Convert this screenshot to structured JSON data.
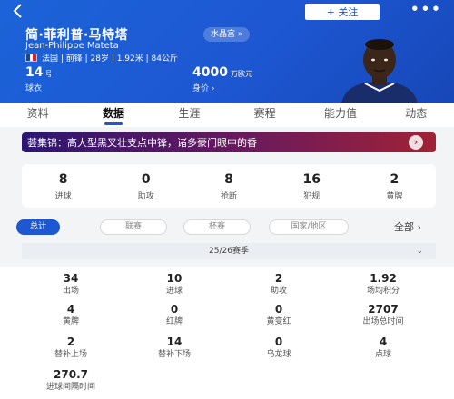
{
  "header": {
    "back_icon": "chevron-left-icon",
    "follow_label": "+ 关注",
    "more_label": "•••",
    "name": "简·菲利普·马特塔",
    "tag": "水晶宫 »",
    "english_name": "Jean-Philippe Mateta",
    "country_flag": "france-flag-icon",
    "info": "法国 | 前锋 | 28岁 | 1.92米 | 84公斤",
    "shirt_number": "14",
    "shirt_unit": "号",
    "shirt_label": "球衣",
    "value": "4000",
    "value_unit": "万欧元",
    "value_label": "身价 ›"
  },
  "tabs": [
    {
      "label": "资料",
      "active": false
    },
    {
      "label": "数据",
      "active": true
    },
    {
      "label": "生涯",
      "active": false
    },
    {
      "label": "赛程",
      "active": false
    },
    {
      "label": "能力值",
      "active": false
    },
    {
      "label": "动态",
      "active": false
    }
  ],
  "banner": {
    "text": "荟集锦：高大型黑叉壮支点中锋，诸多豪门眼中的香",
    "arrow": "›"
  },
  "summary": [
    {
      "value": "8",
      "label": "进球"
    },
    {
      "value": "0",
      "label": "助攻"
    },
    {
      "value": "8",
      "label": "抢断"
    },
    {
      "value": "16",
      "label": "犯规"
    },
    {
      "value": "2",
      "label": "黄牌"
    }
  ],
  "filters": [
    {
      "label": "总计",
      "active": true
    },
    {
      "label": "联赛",
      "active": false
    },
    {
      "label": "杯赛",
      "active": false
    },
    {
      "label": "国家/地区",
      "active": false
    }
  ],
  "filters_all": "全部 ›",
  "season": {
    "label": "25/26赛季",
    "chevron": "⌄"
  },
  "stats": [
    {
      "value": "34",
      "label": "出场"
    },
    {
      "value": "10",
      "label": "进球"
    },
    {
      "value": "2",
      "label": "助攻"
    },
    {
      "value": "1.92",
      "label": "场均积分"
    },
    {
      "value": "4",
      "label": "黄牌"
    },
    {
      "value": "0",
      "label": "红牌"
    },
    {
      "value": "0",
      "label": "黄变红"
    },
    {
      "value": "2707",
      "label": "出场总时间"
    },
    {
      "value": "2",
      "label": "替补上场"
    },
    {
      "value": "14",
      "label": "替补下场"
    },
    {
      "value": "0",
      "label": "乌龙球"
    },
    {
      "value": "4",
      "label": "点球"
    },
    {
      "value": "270.7",
      "label": "进球间隔时间"
    }
  ],
  "colors": {
    "brand": "#1d57d2",
    "banner_start": "#2b1670",
    "banner_end": "#a02236"
  }
}
